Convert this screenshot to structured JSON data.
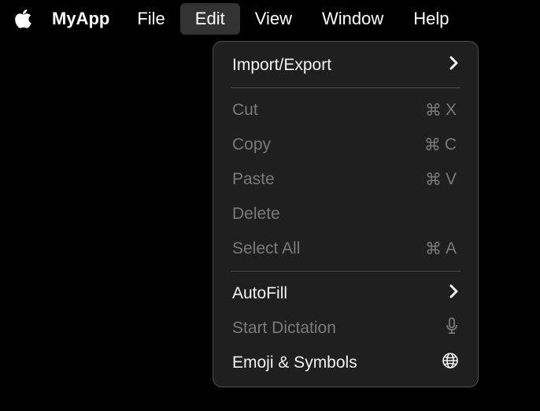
{
  "menubar": {
    "appname": "MyApp",
    "items": [
      "File",
      "Edit",
      "View",
      "Window",
      "Help"
    ],
    "open_index": 1
  },
  "dropdown": {
    "import_export": "Import/Export",
    "cut": {
      "label": "Cut",
      "shortcut_sym": "⌘",
      "shortcut_key": "X"
    },
    "copy": {
      "label": "Copy",
      "shortcut_sym": "⌘",
      "shortcut_key": "C"
    },
    "paste": {
      "label": "Paste",
      "shortcut_sym": "⌘",
      "shortcut_key": "V"
    },
    "delete": {
      "label": "Delete"
    },
    "select_all": {
      "label": "Select All",
      "shortcut_sym": "⌘",
      "shortcut_key": "A"
    },
    "autofill": "AutoFill",
    "start_dictation": "Start Dictation",
    "emoji_symbols": "Emoji & Symbols"
  }
}
